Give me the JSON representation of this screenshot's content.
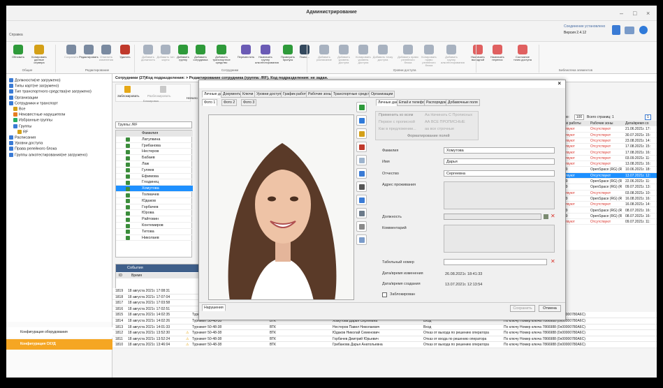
{
  "window": {
    "title": "Администрирование",
    "minimize": "–",
    "maximize": "□",
    "close": "×"
  },
  "menu": {
    "tab": "Справка",
    "conn": "Соединение установлено",
    "version": "Версия 2.4.12"
  },
  "ribbon": {
    "buttons": [
      {
        "label": "Обновить",
        "color": "#2e9a3a"
      },
      {
        "label": "Копировать данные сервера",
        "color": "#d4a017"
      },
      {
        "label": "Сохранить",
        "color": "#7a8aa0",
        "dis": true
      },
      {
        "label": "Редактировать",
        "color": "#7a8aa0"
      },
      {
        "label": "Отменить изменения",
        "color": "#7a8aa0",
        "dis": true
      },
      {
        "label": "Удалить",
        "color": "#c0392b"
      },
      {
        "label": "Добавить должность",
        "color": "#a8b2c0",
        "dis": true
      },
      {
        "label": "Добавить тип карты",
        "color": "#a8b2c0",
        "dis": true
      },
      {
        "label": "Добавить группу",
        "color": "#2e9a3a"
      },
      {
        "label": "Добавить сотрудника",
        "color": "#2e9a3a"
      },
      {
        "label": "Добавить транспортное средство",
        "color": "#2e9a3a"
      },
      {
        "label": "Переместить",
        "color": "#6b5bb5"
      },
      {
        "label": "Назначить группу алкотестирования",
        "color": "#6b5bb5"
      },
      {
        "label": "Проверить пропуск",
        "color": "#2e9a3a"
      },
      {
        "label": "Поиск...",
        "color": "#34495e"
      },
      {
        "label": "Добавить расписание",
        "color": "#a8b2c0",
        "dis": true
      },
      {
        "label": "Добавить уровень доступа",
        "color": "#a8b2c0",
        "dis": true
      },
      {
        "label": "Копировать уровень доступа",
        "color": "#a8b2c0",
        "dis": true
      },
      {
        "label": "Добавить точку доступа",
        "color": "#a8b2c0",
        "dis": true
      },
      {
        "label": "Добавить право релейного блока",
        "color": "#a8b2c0",
        "dis": true
      },
      {
        "label": "Копировать право релейного блока",
        "color": "#a8b2c0",
        "dis": true
      },
      {
        "label": "Добавить группу алкотестирования",
        "color": "#a8b2c0",
        "dis": true
      },
      {
        "label": "Назначить выходной",
        "color": "#e06060"
      },
      {
        "label": "Назначить перенос",
        "color": "#e06060"
      },
      {
        "label": "Состояние точек доступа",
        "color": "#e06060"
      }
    ],
    "groups": [
      "Общие",
      "Редактирование",
      "Сотрудники",
      "Уровни доступа",
      "Библиотека элементов"
    ]
  },
  "nav": {
    "items": [
      "Должности(не загружено)",
      "Типы карт(не загружено)",
      "Тип транспортного средства(не загружено)",
      "Организации",
      "Сотрудники и транспорт",
      "Все",
      "Неизвестные нарушители",
      "Избранные группы",
      "Группы",
      "RF",
      "Расписания",
      "Уровни доступа",
      "Права релейного блока",
      "Группы алкотестирования(не загружено)"
    ],
    "bottom": [
      "Конфигурация оборудования",
      "Конфигурация СКУД"
    ]
  },
  "main": {
    "breadcrumb": "Сотрудники (27)Код подразделения: > Редактирование сотрудника (группа: /RF). Код подразделения: не задан.",
    "lock_label": "Заблокировать",
    "unlock_label": "Разблокировать",
    "start_label": "Начало",
    "lock_group": "Блокировка",
    "groups_path": "Группы: /RF",
    "surname_header": "Фамилия",
    "people": [
      "Латупкина",
      "Грибанова",
      "Нестеров",
      "Бабаев",
      "Лаж",
      "Гуляев",
      "Ефимова",
      "Глодинец",
      "Хомутова",
      "Толмачев",
      "Юдаков",
      "Горбачев",
      "Юрова",
      "Райтовин",
      "Контемиров",
      "Титова",
      "Николаев"
    ],
    "selected_index": 8,
    "pager": {
      "per_page_label": "по:",
      "per_page": "100",
      "total_label": "Всего страниц: 1",
      "page": "1"
    },
    "grid_headers": [
      "ме работы",
      "Рабочие зоны",
      "Дата/время со"
    ],
    "grid_rows": [
      [
        "ствуют",
        "Отсутствуют",
        "21.06.2021г. 17:"
      ],
      [
        "ствуют",
        "Отсутствуют",
        "30.07.2021г. 15:"
      ],
      [
        "ствуют",
        "Отсутствуют",
        "23.08.2021г. 14:"
      ],
      [
        "ствуют",
        "Отсутствуют",
        "17.08.2021г. 15:"
      ],
      [
        "ствуют",
        "Отсутствуют",
        "17.08.2021г. 16:"
      ],
      [
        "ствуют",
        "Отсутствуют",
        "03.09.2021г. 11:"
      ],
      [
        "ствуют",
        "Отсутствуют",
        "13.08.2021г. 16:"
      ],
      [
        "19",
        "OpenSpace (RG) (R",
        "10.06.2021г. 18:"
      ],
      [
        "ствуют",
        "Отсутствуют",
        "13.07.2021г. 12:"
      ],
      [
        "19",
        "OpenSpace (RG) (R",
        "22.06.2021г. 11:"
      ],
      [
        "19",
        "OpenSpace (RG) (R",
        "09.07.2021г. 13:"
      ],
      [
        "ствуют",
        "Отсутствуют",
        "03.08.2021г. 10:"
      ],
      [
        "19",
        "OpenSpace (RG) (R",
        "16.08.2021г. 16:"
      ],
      [
        "ствуют",
        "Отсутствуют",
        "16.08.2021г. 14:"
      ],
      [
        "19",
        "OpenSpace (RG) (R",
        "08.07.2021г. 16:"
      ],
      [
        "19",
        "OpenSpace (RG) (R",
        "08.07.2021г. 16:"
      ],
      [
        "ствуют",
        "Отсутствуют",
        "09.07.2021г. 11:"
      ]
    ],
    "events_title": "События",
    "events_headers": [
      "ID",
      "Время"
    ],
    "events": [
      {
        "id": "1819",
        "t": "18 августа 2021г. 17:08:31"
      },
      {
        "id": "1818",
        "t": "18 августа 2021г. 17:07:04"
      },
      {
        "id": "1817",
        "t": "18 августа 2021г. 17:03:58"
      },
      {
        "id": "1816",
        "t": "18 августа 2021г. 17:02:51"
      },
      {
        "id": "1815",
        "t": "18 августа 2021г. 14:02:35",
        "dev": "Турникет 50-48-38",
        "org": "ВТК",
        "who": "Хомутова Дарья Сергеевна",
        "act": "Выход",
        "how": "По ключу Номер ключа 7866988 (0x00000780A6C)"
      },
      {
        "id": "1814",
        "t": "18 августа 2021г. 14:02:26",
        "dev": "Турникет 50-48-38",
        "org": "ВТК",
        "who": "Хомутова Дарья Сергеевна",
        "act": "Вход",
        "how": "По ключу Номер ключа 7866988 (0x00000780A6C)"
      },
      {
        "id": "1813",
        "t": "18 августа 2021г. 14:01:33",
        "dev": "Турникет 50-48-38",
        "org": "ВТК",
        "who": "Нестеров Павел Николаевич",
        "act": "Вход",
        "how": "По ключу Номер ключа 7866988 (0x00000780A6C)"
      },
      {
        "id": "1812",
        "t": "18 августа 2021г. 13:52:30",
        "dev": "Турникет 50-48-38",
        "org": "ВТК",
        "who": "Юдаков Николай Семенович",
        "act": "Отказ от выхода по решению оператора",
        "how": "По ключу Номер ключа 7866988 (0x00000780A6C)",
        "warn": true
      },
      {
        "id": "1811",
        "t": "18 августа 2021г. 13:52:24",
        "dev": "Турникет 50-48-38",
        "org": "ВТК",
        "who": "Горбачев Дмитрий Юрьевич",
        "act": "Отказ от входа по решению оператора",
        "how": "По ключу Номер ключа 7866988 (0x00000780A6C)",
        "warn": true
      },
      {
        "id": "1810",
        "t": "18 августа 2021г. 13:46:04",
        "dev": "Турникет 50-48-38",
        "org": "ВТК",
        "who": "Грибанова Дарья Анатольевна",
        "act": "Отказ от выхода по решению оператора",
        "how": "По ключу Номер ключа 7866988 (0x00000780A6C)",
        "warn": true
      }
    ]
  },
  "dialog": {
    "close": "×",
    "tabs": [
      "Личные данные",
      "Документы",
      "Ключи",
      "Уровни доступа",
      "График работы",
      "Рабочие зоны",
      "Транспортные средства",
      "Организации"
    ],
    "photo_tabs": [
      "Фото 1",
      "Фото 2",
      "Фото 3"
    ],
    "right_tabs": [
      "Личные данные",
      "Email и телефоны",
      "Распорядок",
      "Добавочные поля"
    ],
    "format": {
      "apply_all": "Применить ко всем",
      "cap_first": "Аа Начинать С Прописных",
      "first_cap": "Первое с прописной",
      "all_caps": "АА ВСЕ ПРОПИСНЫЕ",
      "as_typed": "Как в предложении...",
      "lower": "аа все строчные",
      "title": "Форматирование полей"
    },
    "fields": {
      "surname_l": "Фамилия",
      "surname": "Хомутова",
      "name_l": "Имя",
      "name": "Дарья",
      "patr_l": "Отчество",
      "patr": "Сергеевна",
      "addr_l": "Адрес проживания",
      "pos_l": "Должность",
      "comment_l": "Комментарий",
      "tab_l": "Табельный номер",
      "changed_l": "Дата/время изменения",
      "changed": "26.08.2021г. 18:41:33",
      "created_l": "Дата/время создания",
      "created": "13.07.2021г. 12:13:54",
      "blocked_l": "Заблокирован"
    },
    "violations": "Нарушения",
    "save": "Сохранить",
    "cancel": "Отмена"
  }
}
